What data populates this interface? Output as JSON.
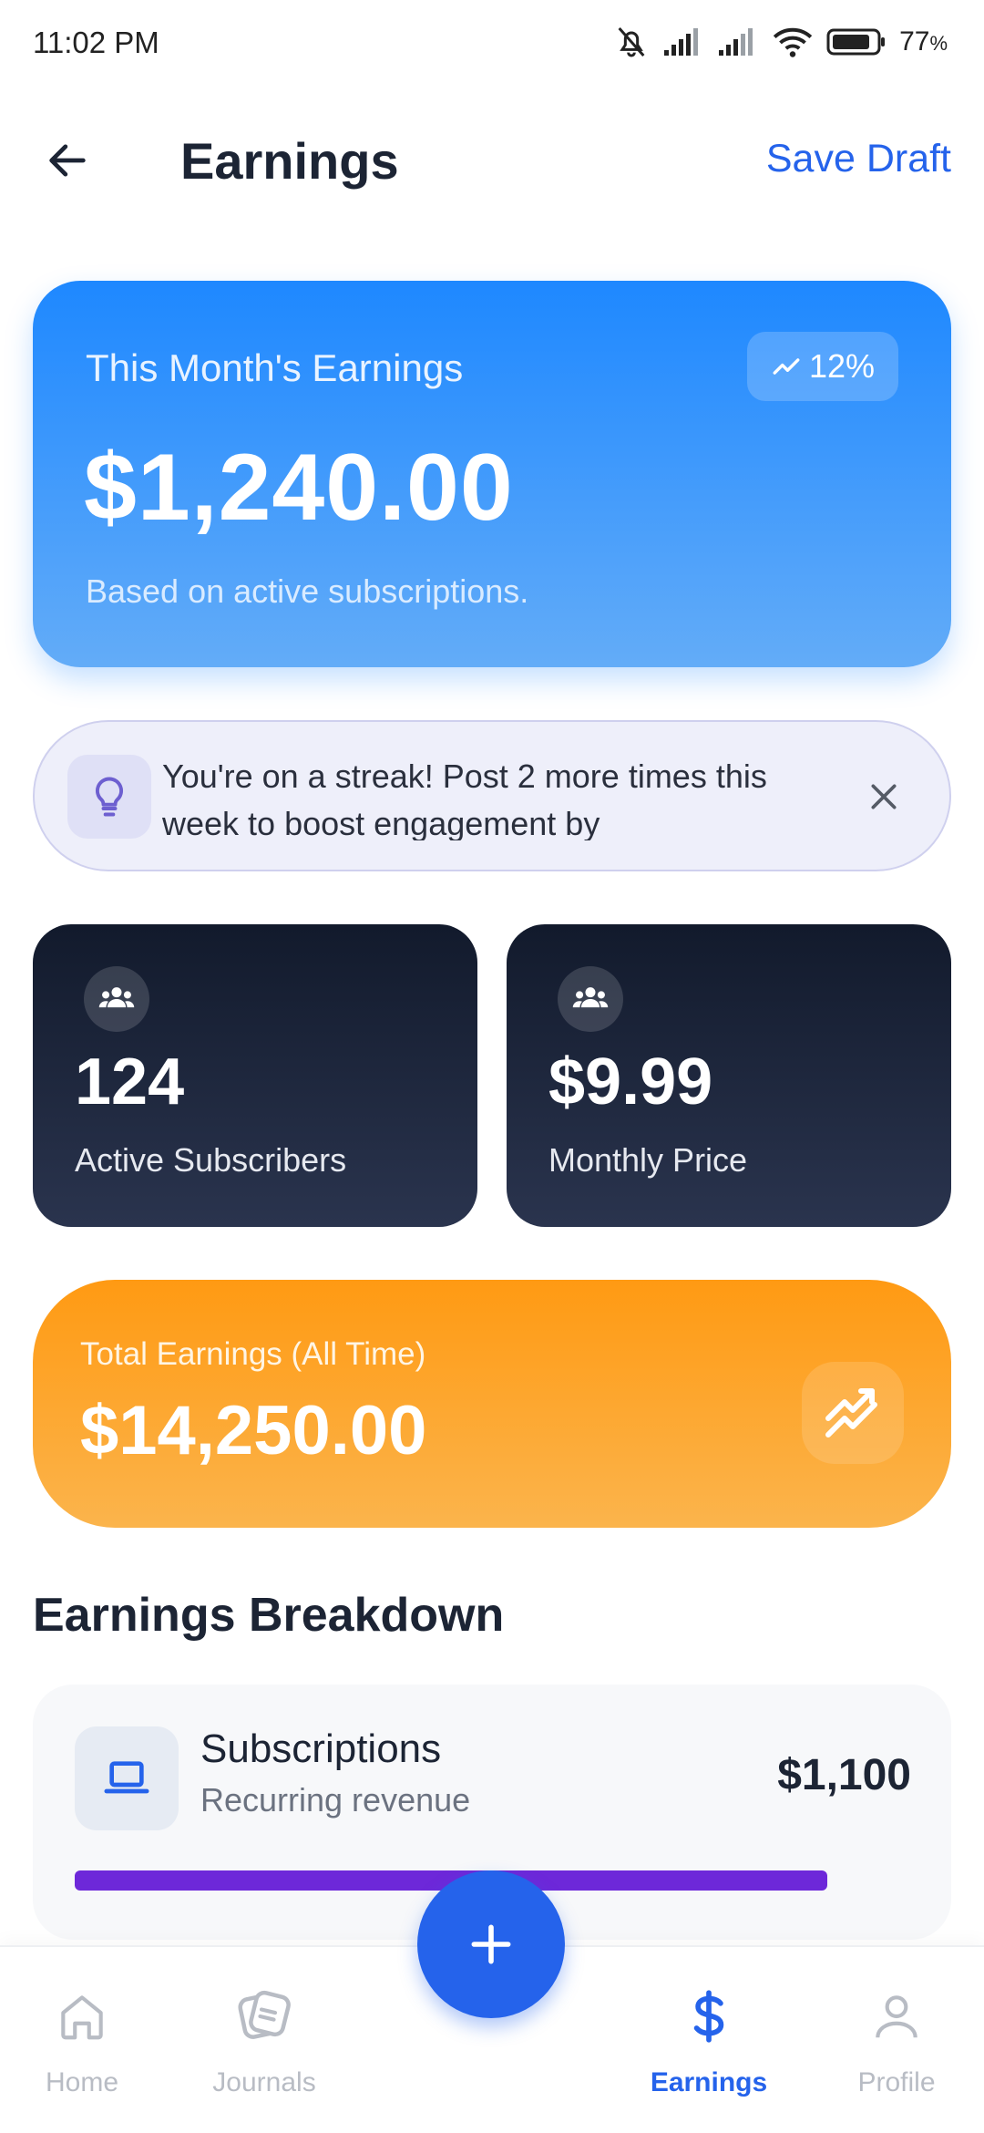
{
  "status_bar": {
    "time": "11:02 PM",
    "battery": "77",
    "battery_unit": "%"
  },
  "header": {
    "title": "Earnings",
    "save_label": "Save Draft"
  },
  "month_card": {
    "label": "This Month's Earnings",
    "amount": "$1,240.00",
    "note": "Based on active subscriptions.",
    "trend": "12%"
  },
  "tip": {
    "text": "You're on a streak! Post 2 more times this week to boost engagement by"
  },
  "stats": [
    {
      "value": "124",
      "label": "Active Subscribers",
      "icon": "group-icon"
    },
    {
      "value": "$9.99",
      "label": "Monthly Price",
      "icon": "group-icon"
    }
  ],
  "total": {
    "label": "Total Earnings (All Time)",
    "amount": "$14,250.00"
  },
  "breakdown": {
    "title": "Earnings Breakdown",
    "items": [
      {
        "title": "Subscriptions",
        "subtitle": "Recurring revenue",
        "amount": "$1,100",
        "icon": "laptop-icon"
      }
    ]
  },
  "nav": {
    "items": [
      {
        "label": "Home",
        "icon": "home-icon"
      },
      {
        "label": "Journals",
        "icon": "journals-icon"
      },
      {
        "label": "Earnings",
        "icon": "dollar-icon"
      },
      {
        "label": "Profile",
        "icon": "profile-icon"
      }
    ],
    "active": "Earnings"
  },
  "colors": {
    "accent": "#2563eb",
    "month_card": "#1e88ff",
    "total_card": "#ff9a13",
    "stat_card": "#121a2c",
    "breakdown_bar": "#6d28d9"
  }
}
